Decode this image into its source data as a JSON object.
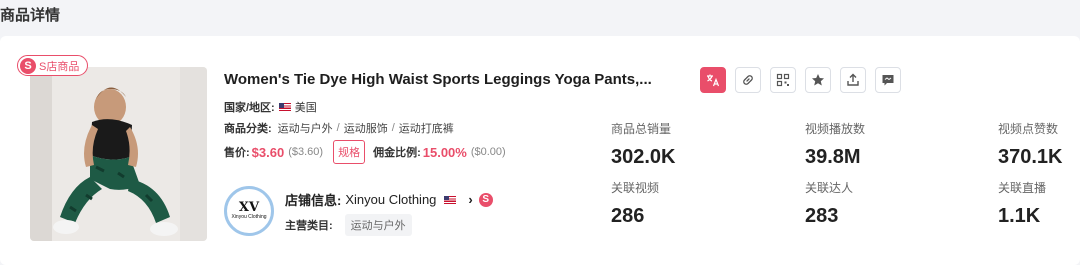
{
  "section_title": "商品详情",
  "badge": {
    "logo": "S",
    "label": "S店商品"
  },
  "product": {
    "title": "Women's Tie Dye High Waist Sports Leggings Yoga Pants,...",
    "country_label": "国家/地区:",
    "country": "美国",
    "category_label": "商品分类:",
    "categories": [
      "运动与户外",
      "运动服饰",
      "运动打底裤"
    ],
    "category_sep": "/",
    "price_label": "售价:",
    "price": "$3.60",
    "price_orig": "($3.60)",
    "spec_button": "规格",
    "commission_label": "佣金比例:",
    "commission": "15.00%",
    "commission_amount": "($0.00)"
  },
  "shop": {
    "avatar_text": "XV",
    "avatar_subtext": "Xinyou Clothing",
    "label": "店铺信息:",
    "name": "Xinyou Clothing",
    "arrow": "›",
    "s_logo": "S",
    "main_category_label": "主营类目:",
    "main_category": "运动与户外"
  },
  "toolbar": {
    "icons": [
      "translate-icon",
      "link-icon",
      "qrcode-icon",
      "star-icon",
      "share-icon",
      "message-icon"
    ],
    "accent": "#e94e6a"
  },
  "stats": [
    {
      "label": "商品总销量",
      "value": "302.0K"
    },
    {
      "label": "视频播放数",
      "value": "39.8M"
    },
    {
      "label": "视频点赞数",
      "value": "370.1K"
    },
    {
      "label": "关联视频",
      "value": "286"
    },
    {
      "label": "关联达人",
      "value": "283"
    },
    {
      "label": "关联直播",
      "value": "1.1K"
    }
  ]
}
